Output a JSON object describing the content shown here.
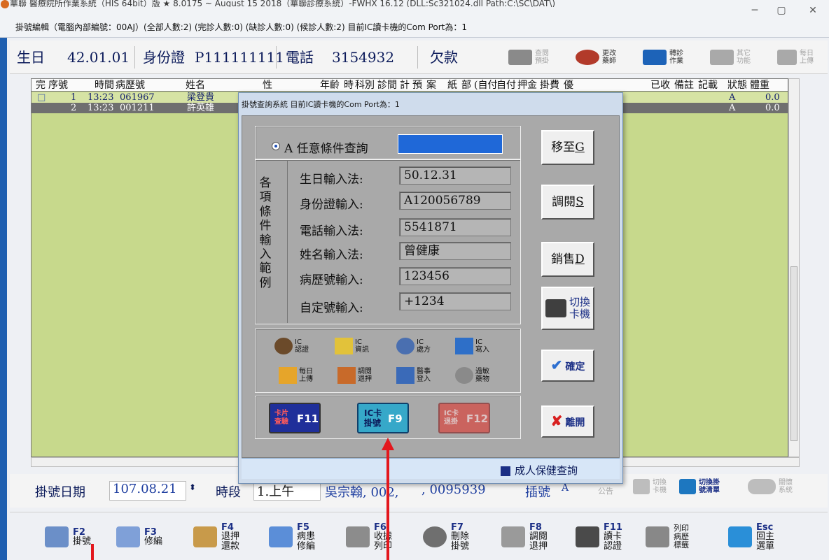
{
  "window": {
    "title": "華聯 醫療院所作業系統（HIS 64bit）版 ★ 8.0175 ~ August 15 2018（華聯診療系統）-FWHX 16.12 (DLL:Sc321024.dll Path:C:\\SC\\DAT\\)",
    "subtitle": "掛號編輯（電腦內部編號：00AJ）(全部人數:2) (完診人數:0) (缺診人數:0) (候診人數:2) 目前IC讀卡機的Com Port為：1",
    "controls": [
      "─",
      "▢",
      "✕"
    ]
  },
  "infobar": {
    "birthday_label": "生日",
    "birthday": "42.01.01",
    "id_label": "身份證",
    "id": "P111111111",
    "phone_label": "電話",
    "phone": "3154932",
    "debt_label": "欠款",
    "buttons": [
      {
        "label": "查閱\n預掛",
        "icon": "calendar-icon",
        "color": "#8a8a8a",
        "dim": true
      },
      {
        "label": "更改\n藥師",
        "icon": "pharmacist-icon",
        "color": "#b23a2a",
        "dim": false
      },
      {
        "label": "轉診\n作業",
        "icon": "referral-icon",
        "color": "#1d63b8",
        "dim": false
      },
      {
        "label": "其它\n功能",
        "icon": "other-icon",
        "color": "#a9a9a9",
        "dim": true
      },
      {
        "label": "每日\n上傳",
        "icon": "upload-icon",
        "color": "#a9a9a9",
        "dim": true
      }
    ]
  },
  "grid": {
    "columns": [
      "完",
      "序號",
      "時間",
      "病歷號",
      "姓名",
      "性",
      "年齡",
      "時",
      "科別",
      "診間",
      "計",
      "預",
      "案",
      "紙",
      "部",
      "(自付",
      "自付",
      "押金",
      "掛費",
      "優",
      "已收",
      "備註",
      "記載",
      "狀態",
      "體重"
    ],
    "rows": [
      {
        "done": "□",
        "no": "1",
        "time": "13:23",
        "chart": "061967",
        "name": "梁登貴",
        "status": "A",
        "weight": "0.0"
      },
      {
        "done": "",
        "no": "2",
        "time": "13:23",
        "chart": "001211",
        "name": "許英雄",
        "status": "A",
        "weight": "0.0"
      }
    ]
  },
  "bottom": {
    "date_label": "掛號日期",
    "date": "107.08.21",
    "period_label": "時段",
    "period": "1.上午",
    "doctor": "吳宗翰, 002,",
    "code": ", 0095939",
    "seq_label": "插號",
    "seq": "A",
    "notice_label": "公告",
    "switch_label": "切換\n卡機",
    "list_label": "切換掛\n號清單",
    "close_label": "關懷\n系統"
  },
  "fkeys": [
    {
      "key": "F2",
      "label": "掛號",
      "color": "#6b8fc8"
    },
    {
      "key": "F3",
      "label": "修編",
      "color": "#7fa0d8"
    },
    {
      "key": "F4",
      "label": "退押\n還款",
      "color": "#c89a4a"
    },
    {
      "key": "F5",
      "label": "病患\n修編",
      "color": "#5b8ed8"
    },
    {
      "key": "F6",
      "label": "收據\n列印",
      "color": "#8c8c8c"
    },
    {
      "key": "F7",
      "label": "刪除\n掛號",
      "color": "#6f6f6f"
    },
    {
      "key": "F8",
      "label": "調閱\n退押",
      "color": "#9a9a9a"
    },
    {
      "key": "F11",
      "label": "讀卡\n認證",
      "color": "#4a4a4a"
    },
    {
      "key": "",
      "label": "列印\n病歷\n標籤",
      "color": "#888888"
    },
    {
      "key": "Esc",
      "label": "回主\n選單",
      "color": "#2a8fd8"
    }
  ],
  "dialog": {
    "title": "掛號查詢系統 目前IC讀卡機的Com Port為：1",
    "query_option": "A 任意條件查詢",
    "side_label": "各項條件輸入範例",
    "examples": [
      {
        "label": "生日輸入法:",
        "value": "50.12.31"
      },
      {
        "label": "身份證輸入:",
        "value": "A120056789"
      },
      {
        "label": "電話輸入法:",
        "value": "5541871"
      },
      {
        "label": "姓名輸入法:",
        "value": "曾健康"
      },
      {
        "label": "病歷號輸入:",
        "value": "123456"
      },
      {
        "label": "自定號輸入:",
        "value": "+1234"
      }
    ],
    "side_buttons": [
      {
        "label": "移至",
        "key": "G"
      },
      {
        "label": "調閱",
        "key": "S"
      },
      {
        "label": "銷售",
        "key": "D"
      }
    ],
    "switch_reader": "切換\n卡機",
    "ic_items": [
      {
        "label": "IC\n認證",
        "icon": "person-card-icon"
      },
      {
        "label": "IC\n資訊",
        "icon": "card-info-icon"
      },
      {
        "label": "IC\n處方",
        "icon": "magnifier-icon"
      },
      {
        "label": "IC\n寫入",
        "icon": "disk-write-icon"
      },
      {
        "label": "每日\n上傳",
        "icon": "upload-folder-icon"
      },
      {
        "label": "調閱\n退押",
        "icon": "review-icon"
      },
      {
        "label": "醫事\n登入",
        "icon": "checkbox-login-icon"
      },
      {
        "label": "過敏\n藥物",
        "icon": "allergy-drug-icon"
      }
    ],
    "confirm": "確定",
    "leave": "離開",
    "func_buttons": [
      {
        "label": "卡片\n查驗",
        "key": "F11",
        "bg": "#1f2f9a"
      },
      {
        "label": "IC卡\n掛號",
        "key": "F9",
        "bg": "#36a8c9"
      },
      {
        "label": "IC卡\n退掛",
        "key": "F12",
        "bg": "#d9463f"
      }
    ],
    "status_text": "成人保健查詢"
  },
  "colors": {
    "grid_bg": "#c7d98c",
    "selected_row": "#6f6f6f",
    "arrow": "#e3171d",
    "dialog_bg": "#a9a9a9"
  }
}
